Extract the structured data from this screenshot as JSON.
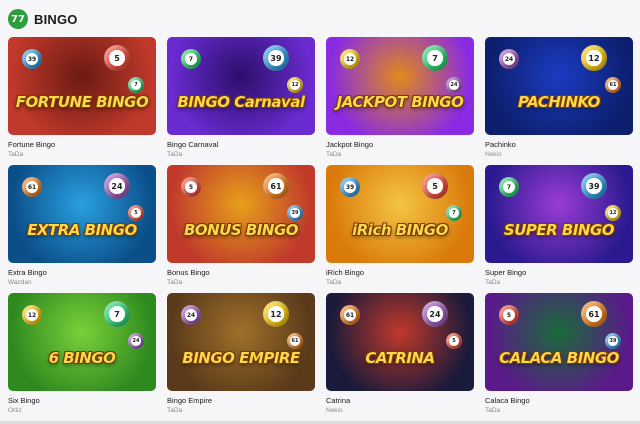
{
  "section": {
    "title": "BINGO",
    "logo_text": "77"
  },
  "games": [
    {
      "name": "Fortune Bingo",
      "provider": "TaDa",
      "art": "FORTUNE BINGO",
      "bg": "#c0392b",
      "bg2": "#6b1a12"
    },
    {
      "name": "Bingo Carnaval",
      "provider": "TaDa",
      "art": "BINGO Carnaval",
      "bg": "#6a2bd0",
      "bg2": "#2b0f6b"
    },
    {
      "name": "Jackpot Bingo",
      "provider": "TaDa",
      "art": "JACKPOT BINGO",
      "bg": "#8a2be2",
      "bg2": "#e08a1a"
    },
    {
      "name": "Pachinko",
      "provider": "Nekio",
      "art": "PACHINKO",
      "bg": "#0d1f6e",
      "bg2": "#1b3cc2"
    },
    {
      "name": "Extra Bingo",
      "provider": "Wazdan",
      "art": "EXTRA BINGO",
      "bg": "#0b4f8a",
      "bg2": "#2aa0e0"
    },
    {
      "name": "Bonus Bingo",
      "provider": "TaDa",
      "art": "BONUS BINGO",
      "bg": "#c0392b",
      "bg2": "#e6a11b"
    },
    {
      "name": "iRich Bingo",
      "provider": "TaDa",
      "art": "iRich BINGO",
      "bg": "#d97a0b",
      "bg2": "#f5c542"
    },
    {
      "name": "Super Bingo",
      "provider": "TaDa",
      "art": "SUPER BINGO",
      "bg": "#2b1a8f",
      "bg2": "#9b3cd6"
    },
    {
      "name": "Six Bingo",
      "provider": "Ortiz",
      "art": "6 BINGO",
      "bg": "#2e8a1f",
      "bg2": "#7ad03a"
    },
    {
      "name": "Bingo Empire",
      "provider": "TaDa",
      "art": "BINGO EMPIRE",
      "bg": "#5a3a1a",
      "bg2": "#a0702a"
    },
    {
      "name": "Catrina",
      "provider": "Nekio",
      "art": "CATRINA",
      "bg": "#1a1a3a",
      "bg2": "#c0392b"
    },
    {
      "name": "Calaca Bingo",
      "provider": "TaDa",
      "art": "CALACA BINGO",
      "bg": "#5a1a8a",
      "bg2": "#1a6b3a"
    }
  ]
}
